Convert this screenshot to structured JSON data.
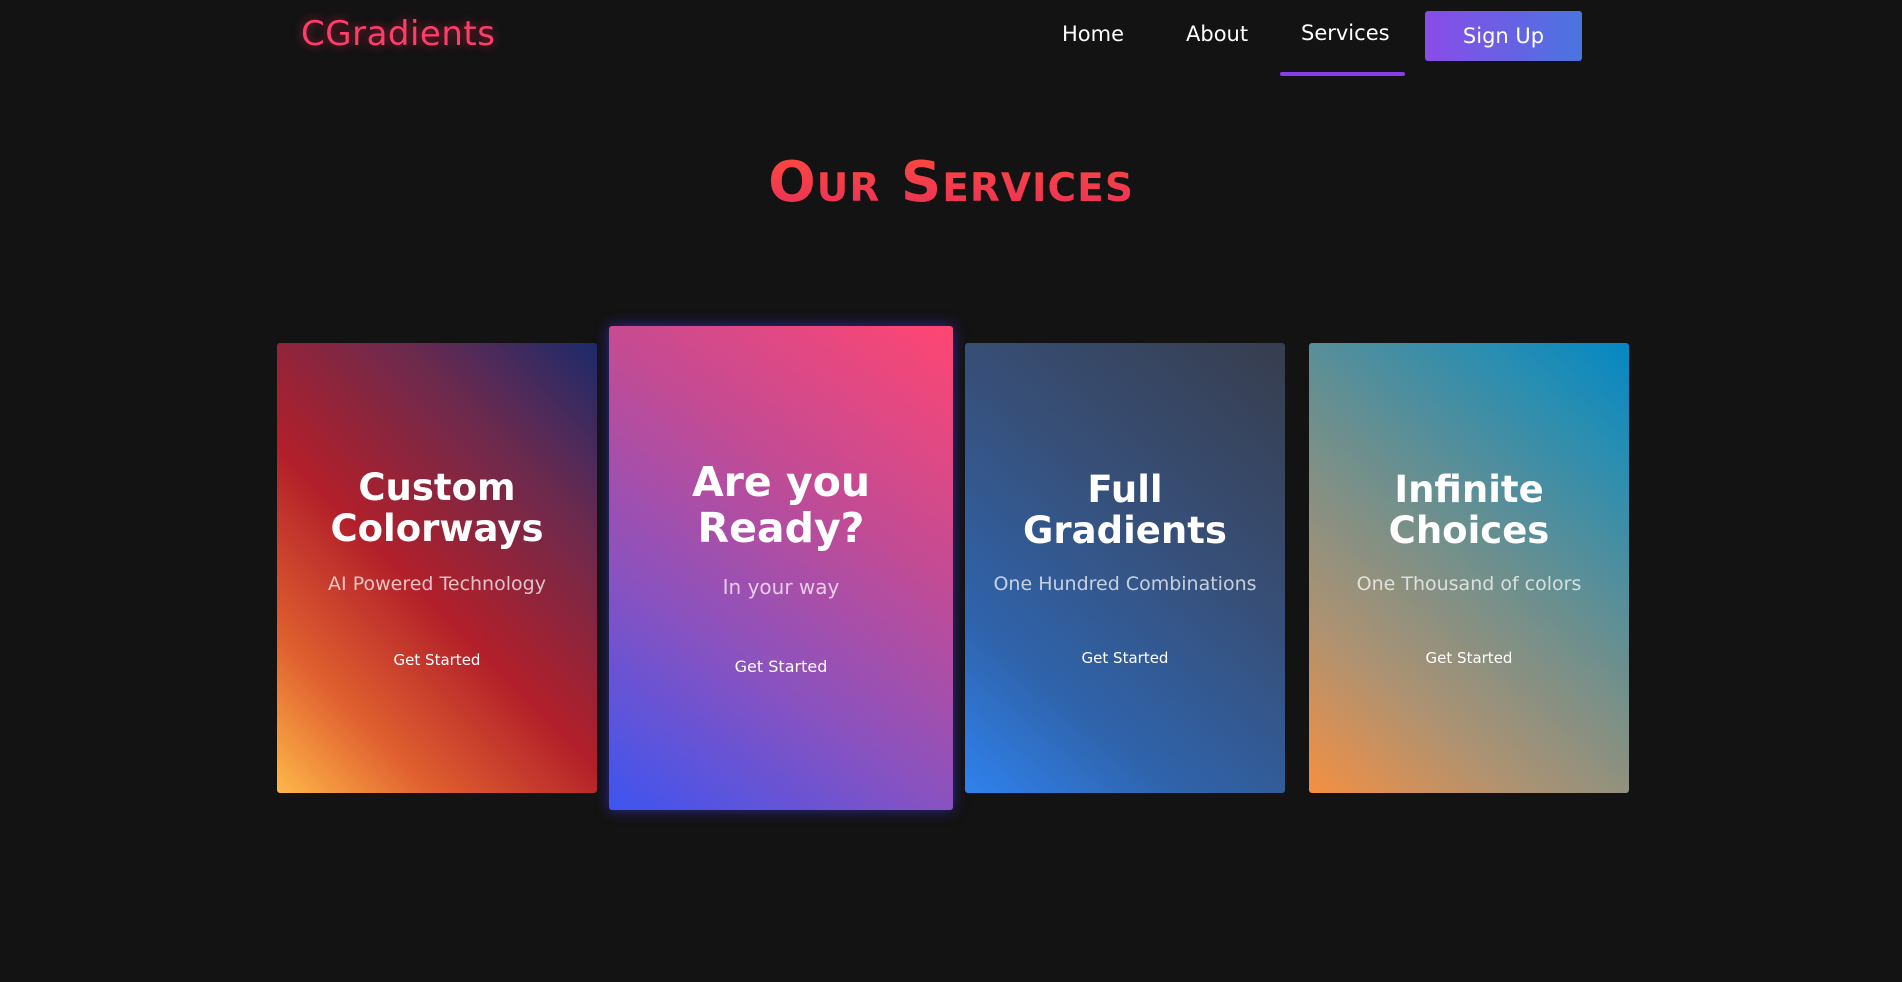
{
  "nav": {
    "logo": "CGradients",
    "links": [
      {
        "label": "Home"
      },
      {
        "label": "About"
      },
      {
        "label": "Services",
        "active": true
      }
    ],
    "signup_label": "Sign Up"
  },
  "heading": "Our Services",
  "cards": [
    {
      "title": "Custom Colorways",
      "subtitle": "AI Powered Technology",
      "cta": "Get Started"
    },
    {
      "title": "Are you Ready?",
      "subtitle": "In your way",
      "cta": "Get Started"
    },
    {
      "title": "Full Gradients",
      "subtitle": "One Hundred Combinations",
      "cta": "Get Started"
    },
    {
      "title": "Infinite Choices",
      "subtitle": "One Thousand of colors",
      "cta": "Get Started"
    }
  ],
  "colors": {
    "background": "#131313",
    "logo": "#ff3d6b",
    "heading": "#ff4a3d",
    "active_underline": "#8a3bea",
    "signup_start": "#8a4ce8",
    "signup_end": "#4a74e0"
  }
}
